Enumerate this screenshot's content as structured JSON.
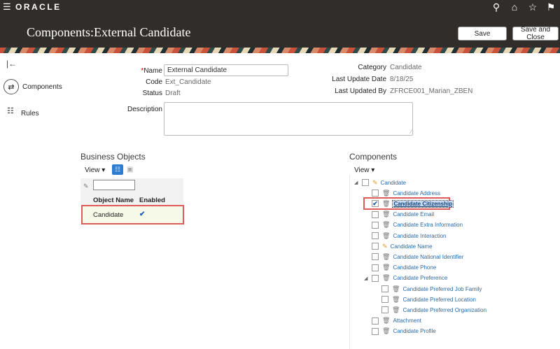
{
  "topbar": {
    "menu_icon": "hamburger-icon",
    "logo": "ORACLE",
    "icons": [
      "search-icon",
      "home-icon",
      "star-icon",
      "flag-icon"
    ]
  },
  "header": {
    "title": "Components:External Candidate",
    "save_label": "Save",
    "save_close_label": "Save and Close"
  },
  "rail": {
    "collapse_icon": "collapse-panel-icon",
    "components_label": "Components",
    "rules_label": "Rules"
  },
  "form": {
    "name_label": "Name",
    "name_required": "*",
    "name_value": "External Candidate",
    "code_label": "Code",
    "code_value": "Ext_Candidate",
    "status_label": "Status",
    "status_value": "Draft",
    "description_label": "Description",
    "description_value": "",
    "category_label": "Category",
    "category_value": "Candidate",
    "last_update_label": "Last Update Date",
    "last_update_value": "8/18/25",
    "last_updated_by_label": "Last Updated By",
    "last_updated_by_value": "ZFRCE001_Marian_ZBEN"
  },
  "business_objects": {
    "title": "Business Objects",
    "view_label": "View ▾",
    "columns": [
      "Object Name",
      "Enabled"
    ],
    "rows": [
      {
        "object_name": "Candidate",
        "enabled": "✔"
      }
    ]
  },
  "components": {
    "title": "Components",
    "view_label": "View ▾",
    "tree": [
      {
        "label": "Candidate",
        "level": 0,
        "expander": "◢",
        "checked": false,
        "icon": "pencil-icon"
      },
      {
        "label": "Candidate Address",
        "level": 1,
        "checked": false,
        "icon": "trash-icon"
      },
      {
        "label": "Candidate Citizenship",
        "level": 1,
        "checked": true,
        "icon": "trash-icon",
        "selected": true
      },
      {
        "label": "Candidate Email",
        "level": 1,
        "checked": false,
        "icon": "trash-icon"
      },
      {
        "label": "Candidate Extra Information",
        "level": 1,
        "checked": false,
        "icon": "trash-icon"
      },
      {
        "label": "Candidate Interaction",
        "level": 1,
        "checked": false,
        "icon": "trash-icon"
      },
      {
        "label": "Candidate Name",
        "level": 1,
        "checked": false,
        "icon": "pencil-icon"
      },
      {
        "label": "Candidate National Identifier",
        "level": 1,
        "checked": false,
        "icon": "trash-icon"
      },
      {
        "label": "Candidate Phone",
        "level": 1,
        "checked": false,
        "icon": "trash-icon"
      },
      {
        "label": "Candidate Preference",
        "level": 1,
        "expander": "◢",
        "checked": false,
        "icon": "trash-icon"
      },
      {
        "label": "Candidate Preferred Job Family",
        "level": 2,
        "checked": false,
        "icon": "trash-icon"
      },
      {
        "label": "Candidate Preferred Location",
        "level": 2,
        "checked": false,
        "icon": "trash-icon"
      },
      {
        "label": "Candidate Preferred Organization",
        "level": 2,
        "checked": false,
        "icon": "trash-icon"
      },
      {
        "label": "Attachment",
        "level": 1,
        "checked": false,
        "icon": "trash-icon"
      },
      {
        "label": "Candidate Profile",
        "level": 1,
        "checked": false,
        "icon": "trash-icon"
      }
    ]
  }
}
